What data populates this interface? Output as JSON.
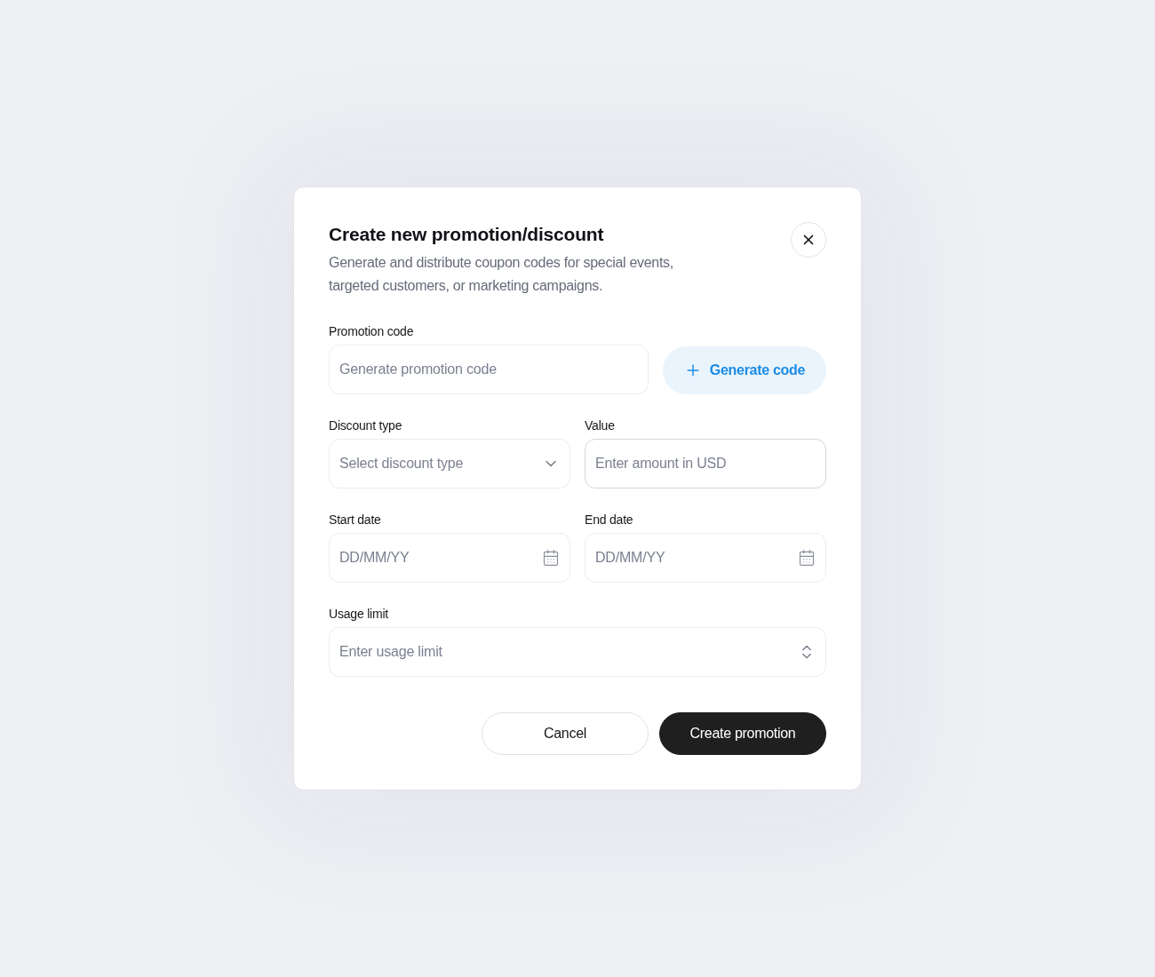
{
  "dialog": {
    "title": "Create new promotion/discount",
    "description": "Generate and distribute coupon codes for special events, targeted customers, or marketing campaigns."
  },
  "promotion_code": {
    "label": "Promotion code",
    "placeholder": "Generate promotion code",
    "focused": false,
    "button": "Generate code"
  },
  "fields": [
    {
      "kind": "select",
      "label": "Discount type",
      "placeholder": "Select discount type",
      "focused": false
    },
    {
      "kind": "text",
      "label": "Value",
      "placeholder": "Enter amount in USD",
      "focused": true
    },
    {
      "kind": "date",
      "label": "Start date",
      "placeholder": "DD/MM/YY",
      "focused": false
    },
    {
      "kind": "date",
      "label": "End date",
      "placeholder": "DD/MM/YY",
      "focused": false
    },
    {
      "kind": "number",
      "label": "Usage limit",
      "placeholder": "Enter usage limit",
      "focused": false
    }
  ],
  "actions": [
    {
      "kind": "secondary",
      "label": "Cancel"
    },
    {
      "kind": "primary",
      "label": "Create promotion"
    }
  ]
}
